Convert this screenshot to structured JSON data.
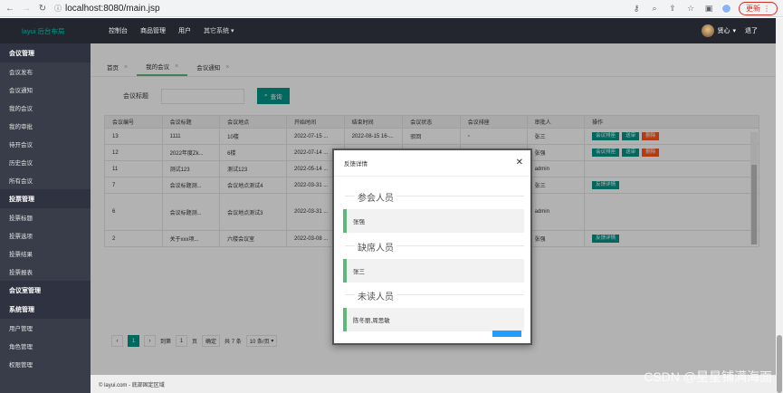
{
  "browser": {
    "url": "localhost:8080/main.jsp",
    "update": "更新"
  },
  "header": {
    "logo": "layui 后台布局",
    "nav": [
      "控制台",
      "商品管理",
      "用户",
      "其它系统"
    ],
    "user": "贤心",
    "logout": "退了"
  },
  "sidebar": [
    {
      "g": "会议管理"
    },
    {
      "i": "会议发布"
    },
    {
      "i": "会议通知"
    },
    {
      "i": "我的会议"
    },
    {
      "i": "我的审批"
    },
    {
      "i": "待开会议"
    },
    {
      "i": "历史会议"
    },
    {
      "i": "所有会议"
    },
    {
      "g": "投票管理"
    },
    {
      "i": "投票标题"
    },
    {
      "i": "投票选项"
    },
    {
      "i": "投票结果"
    },
    {
      "i": "投票报表"
    },
    {
      "g": "会议室管理"
    },
    {
      "g": "系统管理"
    },
    {
      "i": "用户管理"
    },
    {
      "i": "角色管理"
    },
    {
      "i": "权限管理"
    }
  ],
  "tabs": [
    "首页",
    "我的会议",
    "会议通知"
  ],
  "search": {
    "label": "会议标题",
    "button": "查询"
  },
  "table": {
    "columns": [
      "会议编号",
      "会议标题",
      "会议地点",
      "开始时间",
      "结束时间",
      "会议状态",
      "会议排座",
      "审批人",
      "操作"
    ],
    "rows": [
      [
        "13",
        "1111",
        "10楼",
        "2022-07-15 ...",
        "2022-08-15 16-...",
        "驳回",
        "",
        "张三",
        [
          "会议排座",
          "送审",
          "删除"
        ]
      ],
      [
        "12",
        "2022年度Zk...",
        "6楼",
        "2022-07-14 ...",
        "",
        "",
        "",
        "张强",
        [
          "会议排座",
          "送审",
          "删除"
        ]
      ],
      [
        "11",
        "测试123",
        "测试123",
        "2022-05-14 ...",
        "",
        "",
        "",
        "admin",
        []
      ],
      [
        "7",
        "会议标题测...",
        "会议地点测试4",
        "2022-03-31 ...",
        "",
        "",
        "",
        "张三",
        [
          "反馈详情"
        ]
      ],
      [
        "6",
        "会议标题测...",
        "会议地点测试3",
        "2022-03-31 ...",
        "",
        "",
        "",
        "admin",
        []
      ],
      [
        "2",
        "关于xxx项...",
        "六楼会议室",
        "2022-03-08 ...",
        "",
        "",
        "",
        "张强",
        [
          "反馈详情"
        ]
      ]
    ]
  },
  "pager": {
    "page": "1",
    "goto": "到第",
    "page_input": "1",
    "page_word": "页",
    "confirm": "确定",
    "total": "共 7 条",
    "per_page": "10 条/页"
  },
  "modal": {
    "title": "反馈详情",
    "sections": [
      {
        "label": "参会人员",
        "names": "张强"
      },
      {
        "label": "缺席人员",
        "names": "张三"
      },
      {
        "label": "未读人员",
        "names": "陈冬丽,周思敏"
      }
    ]
  },
  "footer": "© layui.com - 底部固定区域",
  "watermark": "CSDN @星星铺满海面"
}
